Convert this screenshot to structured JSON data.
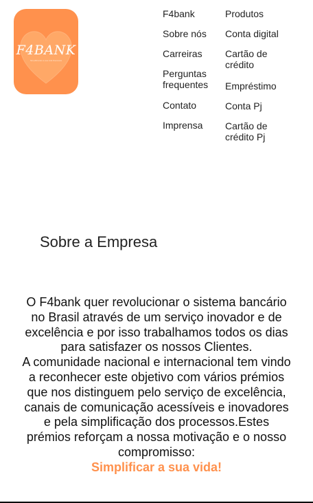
{
  "logo": {
    "word": "F4BANK",
    "tagline": "Simplificando a sua vida financeira"
  },
  "nav": {
    "column1": [
      {
        "label": "F4bank"
      },
      {
        "label": "Sobre nós"
      },
      {
        "label": "Carreiras"
      },
      {
        "label": "Perguntas frequentes"
      },
      {
        "label": "Contato"
      },
      {
        "label": "Imprensa"
      }
    ],
    "column2": [
      {
        "label": "Produtos"
      },
      {
        "label": "Conta digital"
      },
      {
        "label": "Cartão de crédito"
      },
      {
        "label": "Empréstimo"
      },
      {
        "label": "Conta Pj"
      },
      {
        "label": "Cartão de crédito Pj"
      }
    ]
  },
  "about": {
    "title": "Sobre a Empresa",
    "paragraph1": "O F4bank quer revolucionar o sistema bancário no Brasil através de um serviço inovador e de excelência e por isso trabalhamos todos os dias para satisfazer os nossos Clientes.",
    "paragraph2": "A comunidade nacional e internacional tem vindo a reconhecer este objetivo com vários prémios que nos distinguem pelo serviço de excelência, canais de comunicação acessíveis e inovadores e pela simplificação dos processos.Estes prémios reforçam a nossa motivação e o nosso compromisso:",
    "slogan": "Simplificar a sua vida!"
  },
  "colors": {
    "brand_orange": "#ff914d",
    "text": "#222222",
    "background": "#ffffff"
  }
}
